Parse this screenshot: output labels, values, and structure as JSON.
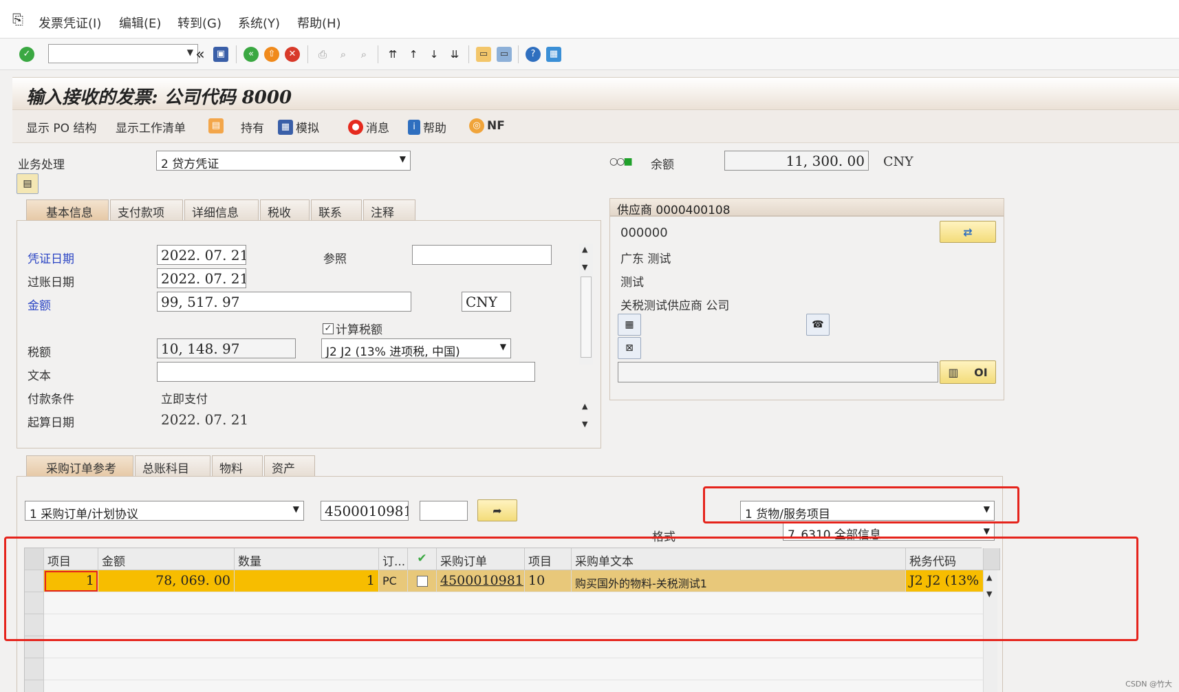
{
  "menu": {
    "items": [
      "发票凭证(I)",
      "编辑(E)",
      "转到(G)",
      "系统(Y)",
      "帮助(H)"
    ]
  },
  "title": "输入接收的发票: 公司代码 8000",
  "app_toolbar": {
    "show_po": "显示 PO 结构",
    "show_worklist": "显示工作清单",
    "hold": "持有",
    "simulate": "模拟",
    "messages": "消息",
    "help": "帮助",
    "nf": "NF"
  },
  "transaction": {
    "label": "业务处理",
    "value": "2 贷方凭证"
  },
  "balance": {
    "label": "余额",
    "value": "11, 300. 00",
    "currency": "CNY"
  },
  "tabs_top": [
    "基本信息",
    "支付款项",
    "详细信息",
    "税收",
    "联系",
    "注释"
  ],
  "basic": {
    "doc_date_label": "凭证日期",
    "doc_date": "2022. 07. 21",
    "ref_label": "参照",
    "ref_value": "",
    "post_date_label": "过账日期",
    "post_date": "2022. 07. 21",
    "amount_label": "金额",
    "amount": "99, 517. 97",
    "currency": "CNY",
    "calc_tax_label": "计算税额",
    "tax_label": "税额",
    "tax": "10, 148. 97",
    "tax_code": "J2 J2 (13% 进项税, 中国)",
    "text_label": "文本",
    "text_value": "",
    "payterm_label": "付款条件",
    "payterm": "立即支付",
    "baseline_label": "起算日期",
    "baseline": "2022. 07. 21"
  },
  "vendor": {
    "header": "供应商 0000400108",
    "code": "000000",
    "line1": "广东  测试",
    "line2": "测试",
    "line3": "关税测试供应商 公司",
    "oi": "OI"
  },
  "tabs_bottom": [
    "采购订单参考",
    "总账科目",
    "物料",
    "资产"
  ],
  "po_ref": {
    "type": "1 采购订单/计划协议",
    "po_number": "4500010981",
    "item_value": "",
    "goods_service": "1 货物/服务项目",
    "layout_label": "格式",
    "layout_value": "7_6310 全部信息"
  },
  "grid": {
    "headers": [
      "项目",
      "金额",
      "数量",
      "订...",
      "",
      "采购订单",
      "项目",
      "采购单文本",
      "税务代码"
    ],
    "rows": [
      [
        "1",
        "78, 069. 00",
        "1",
        "PC",
        "",
        "4500010981",
        "10",
        "购买国外的物料-关税测试1",
        "J2  J2 (13%"
      ]
    ]
  },
  "watermark": "CSDN @竹大"
}
